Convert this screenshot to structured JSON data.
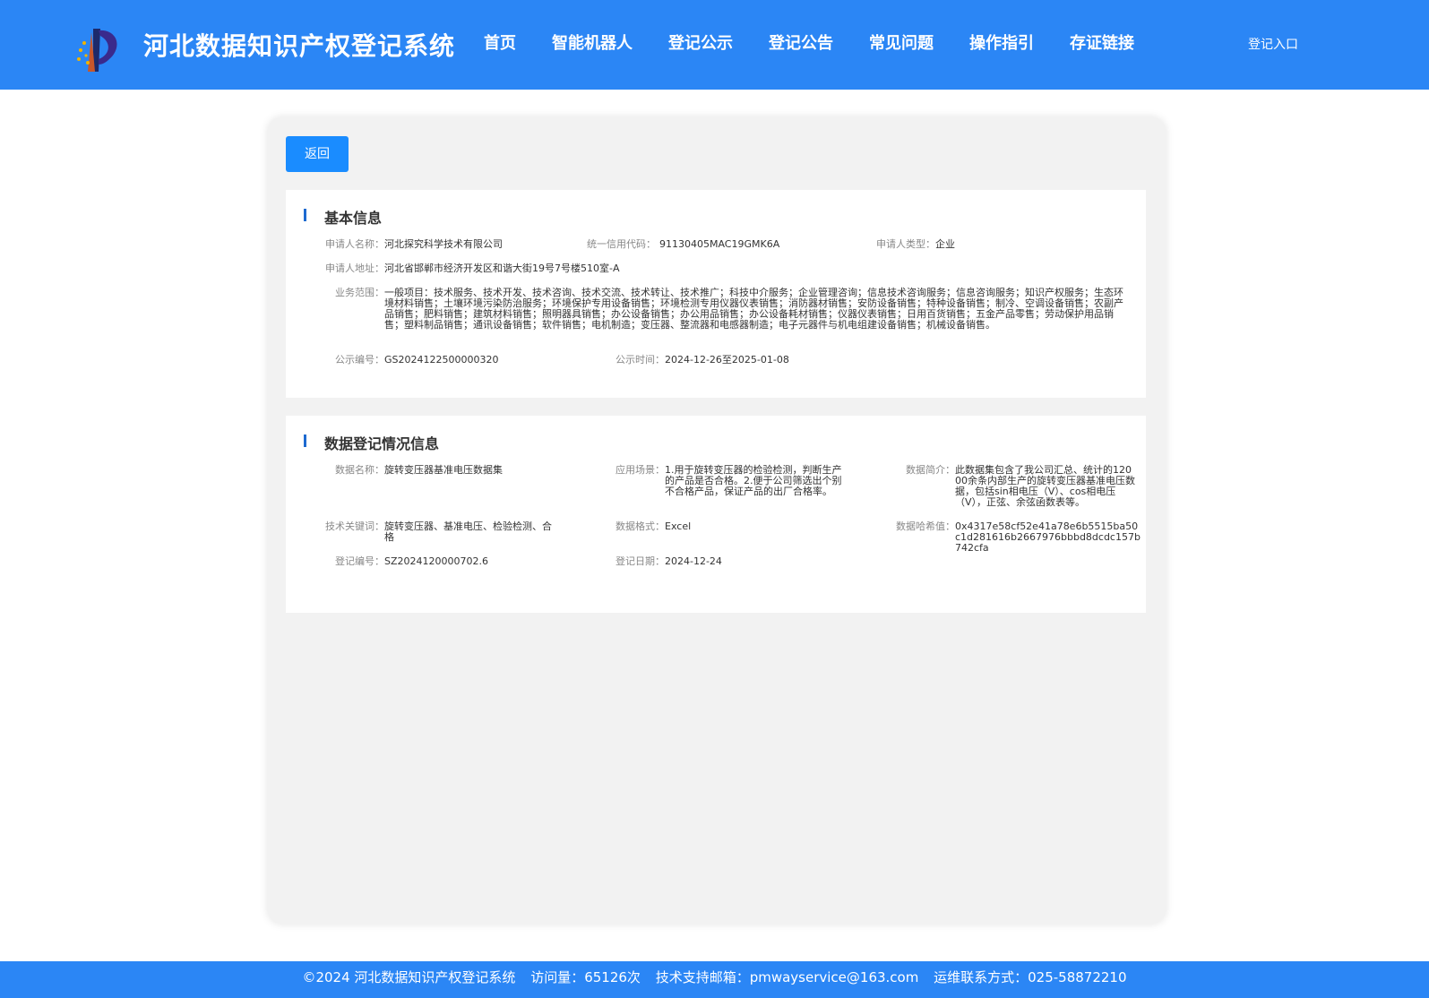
{
  "header": {
    "title": "河北数据知识产权登记系统",
    "nav": [
      "首页",
      "智能机器人",
      "登记公示",
      "登记公告",
      "常见问题",
      "操作指引",
      "存证链接"
    ],
    "login": "登记入口",
    "logo_icon": "logo-icon"
  },
  "back_button": "返回",
  "basic_info": {
    "title": "基本信息",
    "applicant_name_label": "申请人名称：",
    "applicant_name": "河北探究科学技术有限公司",
    "credit_code_label": "统一信用代码：",
    "credit_code": "91130405MAC19GMK6A",
    "applicant_type_label": "申请人类型：",
    "applicant_type": "企业",
    "address_label": "申请人地址：",
    "address": "河北省邯郸市经济开发区和谐大街19号7号楼510室-A",
    "scope_label": "业务范围：",
    "scope": "一般项目：技术服务、技术开发、技术咨询、技术交流、技术转让、技术推广；科技中介服务；企业管理咨询；信息技术咨询服务；信息咨询服务；知识产权服务；生态环境材料销售；土壤环境污染防治服务；环境保护专用设备销售；环境检测专用仪器仪表销售；消防器材销售；安防设备销售；特种设备销售；制冷、空调设备销售；农副产品销售；肥料销售；建筑材料销售；照明器具销售；办公设备销售；办公用品销售；办公设备耗材销售；仪器仪表销售；日用百货销售；五金产品零售；劳动保护用品销售；塑料制品销售；通讯设备销售；软件销售；电机制造；变压器、整流器和电感器制造；电子元器件与机电组建设备销售；机械设备销售。",
    "notice_no_label": "公示编号：",
    "notice_no": "GS2024122500000320",
    "notice_time_label": "公示时间：",
    "notice_time": "2024-12-26至2025-01-08"
  },
  "data_info": {
    "title": "数据登记情况信息",
    "data_name_label": "数据名称：",
    "data_name": "旋转变压器基准电压数据集",
    "scenario_label": "应用场景：",
    "scenario": "1.用于旋转变压器的检验检测，判断生产的产品是否合格。2.便于公司筛选出个别不合格产品，保证产品的出厂合格率。",
    "summary_label": "数据简介：",
    "summary": "此数据集包含了我公司汇总、统计的12000余条内部生产的旋转变压器基准电压数据，包括sin相电压（V）、cos相电压（V），正弦、余弦函数表等。",
    "keywords_label": "技术关键词：",
    "keywords": "旋转变压器、基准电压、检验检测、合格",
    "format_label": "数据格式：",
    "format": "Excel",
    "hash_label": "数据哈希值：",
    "hash": "0x4317e58cf52e41a78e6b5515ba50c1d281616b2667976bbbd8dcdc157b742cfa",
    "reg_no_label": "登记编号：",
    "reg_no": "SZ2024120000702.6",
    "reg_date_label": "登记日期：",
    "reg_date": "2024-12-24"
  },
  "footer": {
    "copyright": "©2024 河北数据知识产权登记系统",
    "visits": "访问量：65126次",
    "email": "技术支持邮箱：pmwayservice@163.com",
    "phone": "运维联系方式：025-58872210"
  }
}
